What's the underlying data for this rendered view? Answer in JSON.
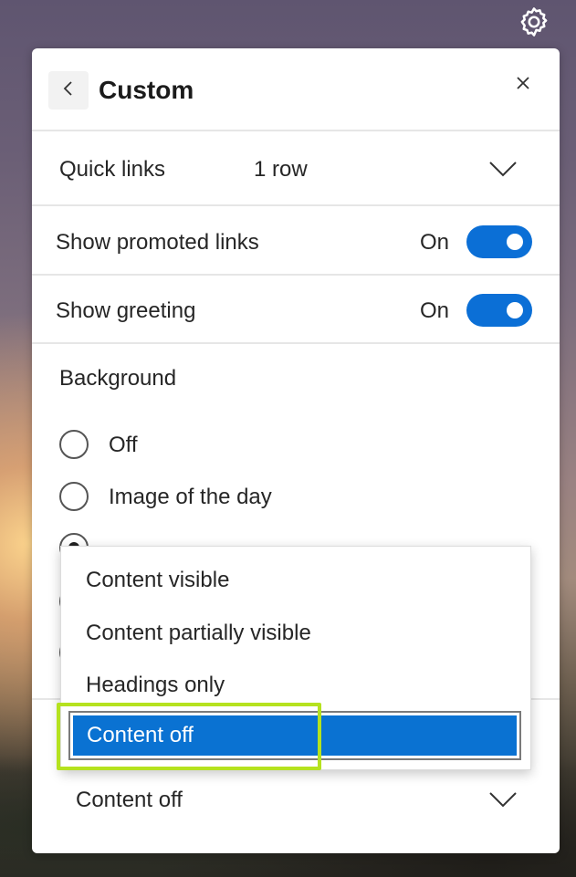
{
  "header": {
    "title": "Custom"
  },
  "quick_links": {
    "label": "Quick links",
    "value": "1 row"
  },
  "promoted_links": {
    "label": "Show promoted links",
    "state": "On"
  },
  "greeting": {
    "label": "Show greeting",
    "state": "On"
  },
  "background": {
    "label": "Background",
    "options": [
      "Off",
      "Image of the day"
    ],
    "selected_index": 2
  },
  "content_dropdown": {
    "options": [
      "Content visible",
      "Content partially visible",
      "Headings only",
      "Content off"
    ],
    "selected": "Content off"
  },
  "content_select": {
    "value": "Content off"
  },
  "colors": {
    "accent": "#0b6fd6",
    "selected_item": "#0a72d2",
    "highlight": "#b5e21f"
  },
  "icons": [
    "settings-gear-icon",
    "back-arrow-icon",
    "close-icon",
    "chevron-down-icon"
  ]
}
